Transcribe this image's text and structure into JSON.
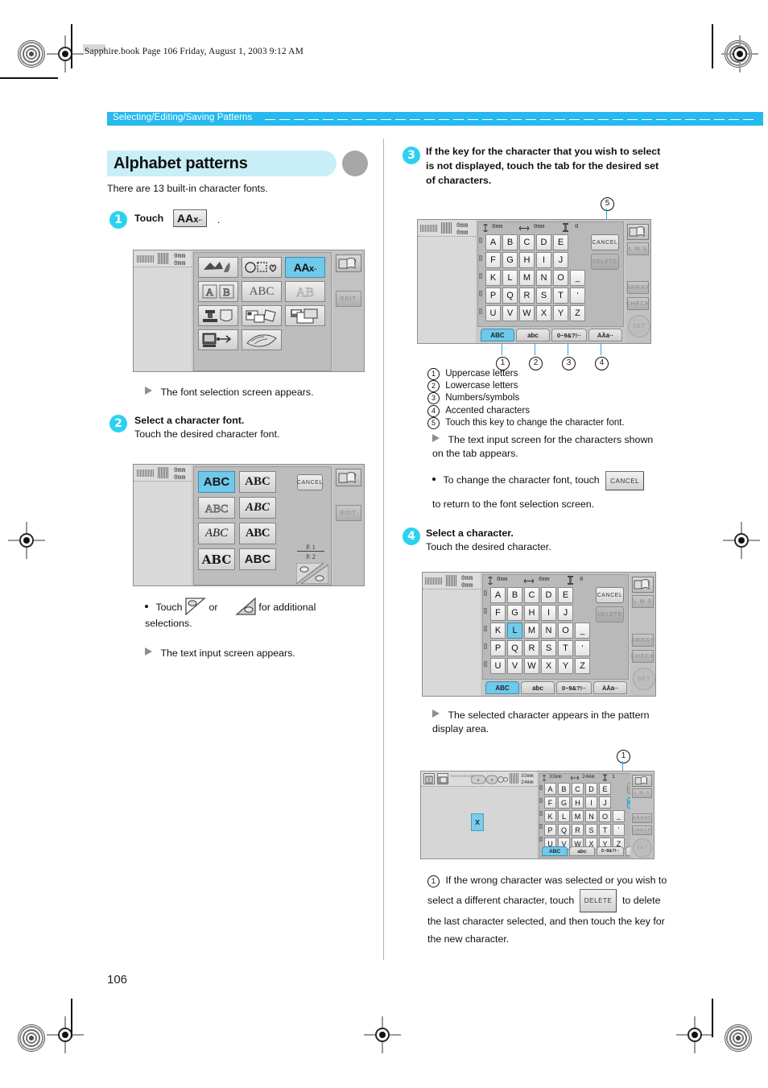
{
  "page": {
    "running_header": "Sapphire.book  Page 106  Friday, August 1, 2003  9:12 AM",
    "section_label": "Selecting/Editing/Saving Patterns",
    "page_number": "106",
    "accent_cyan": "#25b9ef",
    "title_pill_bg": "#c8eef8",
    "lcd_highlight": "#6ec9ea"
  },
  "title": {
    "heading": "Alphabet patterns",
    "intro": "There are 13 built-in character fonts."
  },
  "steps": {
    "step1": {
      "num": "1",
      "label": "Touch",
      "key_glyph": "AAA··",
      "period": ".",
      "result": "The font selection screen appears."
    },
    "step2": {
      "num": "2",
      "title": "Select a character font.",
      "body": "Touch the desired character font.",
      "note_pre": "Touch",
      "note_mid": "or",
      "note_post": "for additional",
      "note_cont": "selections.",
      "result": "The text input screen appears."
    },
    "step3": {
      "num": "3",
      "title": "If the key for the character that you wish to select is not displayed, touch the tab for the desired set of characters.",
      "callout_top": "5",
      "legend": [
        {
          "n": "1",
          "text": "Uppercase letters"
        },
        {
          "n": "2",
          "text": "Lowercase letters"
        },
        {
          "n": "3",
          "text": "Numbers/symbols"
        },
        {
          "n": "4",
          "text": "Accented characters"
        },
        {
          "n": "5",
          "text": "Touch this key to change the character font."
        }
      ],
      "result": "The text input screen for the characters shown on the tab appears.",
      "note_pre": "To change the character font, touch",
      "note_key": "CANCEL",
      "note_post": "to return to the font selection screen."
    },
    "step4": {
      "num": "4",
      "title": "Select a character.",
      "body": "Touch the desired character.",
      "result": "The selected character appears in the pattern display area.",
      "callout_num": "1",
      "footnote_num": "1",
      "footnote": "If the wrong character was selected or you wish to select a different character, touch",
      "footnote_key": "DELETE",
      "footnote_cont_a": "to",
      "footnote_cont": "delete the last character selected, and then touch the key for the new character."
    }
  },
  "screen_pattern_type": {
    "name": "pattern-type-selection-screen",
    "dim_v": "0mm",
    "dim_h": "0mm",
    "edit_label": "EDIT",
    "buttons": [
      {
        "id": "embroidery-patterns",
        "glyph": "bird-flower-icon",
        "selected": false
      },
      {
        "id": "frame-patterns",
        "glyph": "circle-square-heart-icon",
        "selected": false
      },
      {
        "id": "alphabet-patterns",
        "glyph": "AAA",
        "selected": true
      },
      {
        "id": "decorative-alphabet",
        "glyph": "AB-frame-icon",
        "selected": false
      },
      {
        "id": "floral-alphabet",
        "glyph": "ABC",
        "selected": false
      },
      {
        "id": "outline-alphabet",
        "glyph": "AB-outline-icon",
        "selected": false
      },
      {
        "id": "quilting-patterns",
        "glyph": "machine-pocket-icon",
        "selected": false
      },
      {
        "id": "card-patterns",
        "glyph": "memory-card-icon",
        "selected": false
      },
      {
        "id": "saved-patterns",
        "glyph": "floppy-icon",
        "selected": false
      },
      {
        "id": "usb-patterns",
        "glyph": "computer-usb-icon",
        "selected": false
      },
      {
        "id": "design-patterns",
        "glyph": "fabric-stack-icon",
        "selected": false
      }
    ]
  },
  "screen_font_selection": {
    "name": "font-selection-screen",
    "dim_v": "0mm",
    "dim_h": "0mm",
    "cancel_label": "CANCEL",
    "edit_label": "EDIT",
    "page_top": "P.  1",
    "page_bottom": "P.  2",
    "fonts": [
      {
        "label": "ABC",
        "style": "sans-bold",
        "selected": true
      },
      {
        "label": "ABC",
        "style": "serif-bold",
        "selected": false
      },
      {
        "label": "ABC",
        "style": "outline",
        "selected": false
      },
      {
        "label": "ABC",
        "style": "script",
        "selected": false
      },
      {
        "label": "ABC",
        "style": "italic-serif",
        "selected": false
      },
      {
        "label": "ABC",
        "style": "slab",
        "selected": false
      },
      {
        "label": "ABC",
        "style": "blackletter",
        "selected": false
      },
      {
        "label": "ABC",
        "style": "heavy",
        "selected": false
      }
    ]
  },
  "screen_keyboard": {
    "name": "text-input-screen",
    "dim_v": "0mm",
    "dim_h": "0mm",
    "size_v": "0mm",
    "size_h": "0mm",
    "stitch_count": "0",
    "keys": [
      [
        "A",
        "B",
        "C",
        "D",
        "E"
      ],
      [
        "F",
        "G",
        "H",
        "I",
        "J"
      ],
      [
        "K",
        "L",
        "M",
        "N",
        "O"
      ],
      [
        "P",
        "Q",
        "R",
        "S",
        "T"
      ],
      [
        "U",
        "V",
        "W",
        "X",
        "Y"
      ]
    ],
    "extra_keys": [
      "_",
      "'",
      "Z"
    ],
    "cancel_label": "CANCEL",
    "delete_label": "DELETE",
    "side_buttons": [
      "L M S",
      "ARRAY",
      "CHECK"
    ],
    "set_label": "SET",
    "tabs": [
      {
        "label": "ABC",
        "name": "uppercase-tab",
        "selected": true
      },
      {
        "label": "abc",
        "name": "lowercase-tab",
        "selected": false
      },
      {
        "label": "0~9&?!··",
        "name": "numbers-symbols-tab",
        "selected": false
      },
      {
        "label": "ÄÅä··",
        "name": "accented-tab",
        "selected": false
      }
    ]
  },
  "screen_keyboard_selected": {
    "name": "text-input-screen-L-selected",
    "selected_key": "L"
  },
  "screen_pattern_display": {
    "name": "pattern-display-screen",
    "size_v": "33mm",
    "size_h": "24mm",
    "stitch_count": "1",
    "toolbar_label": "New Embroidery",
    "delete_highlighted": true
  }
}
